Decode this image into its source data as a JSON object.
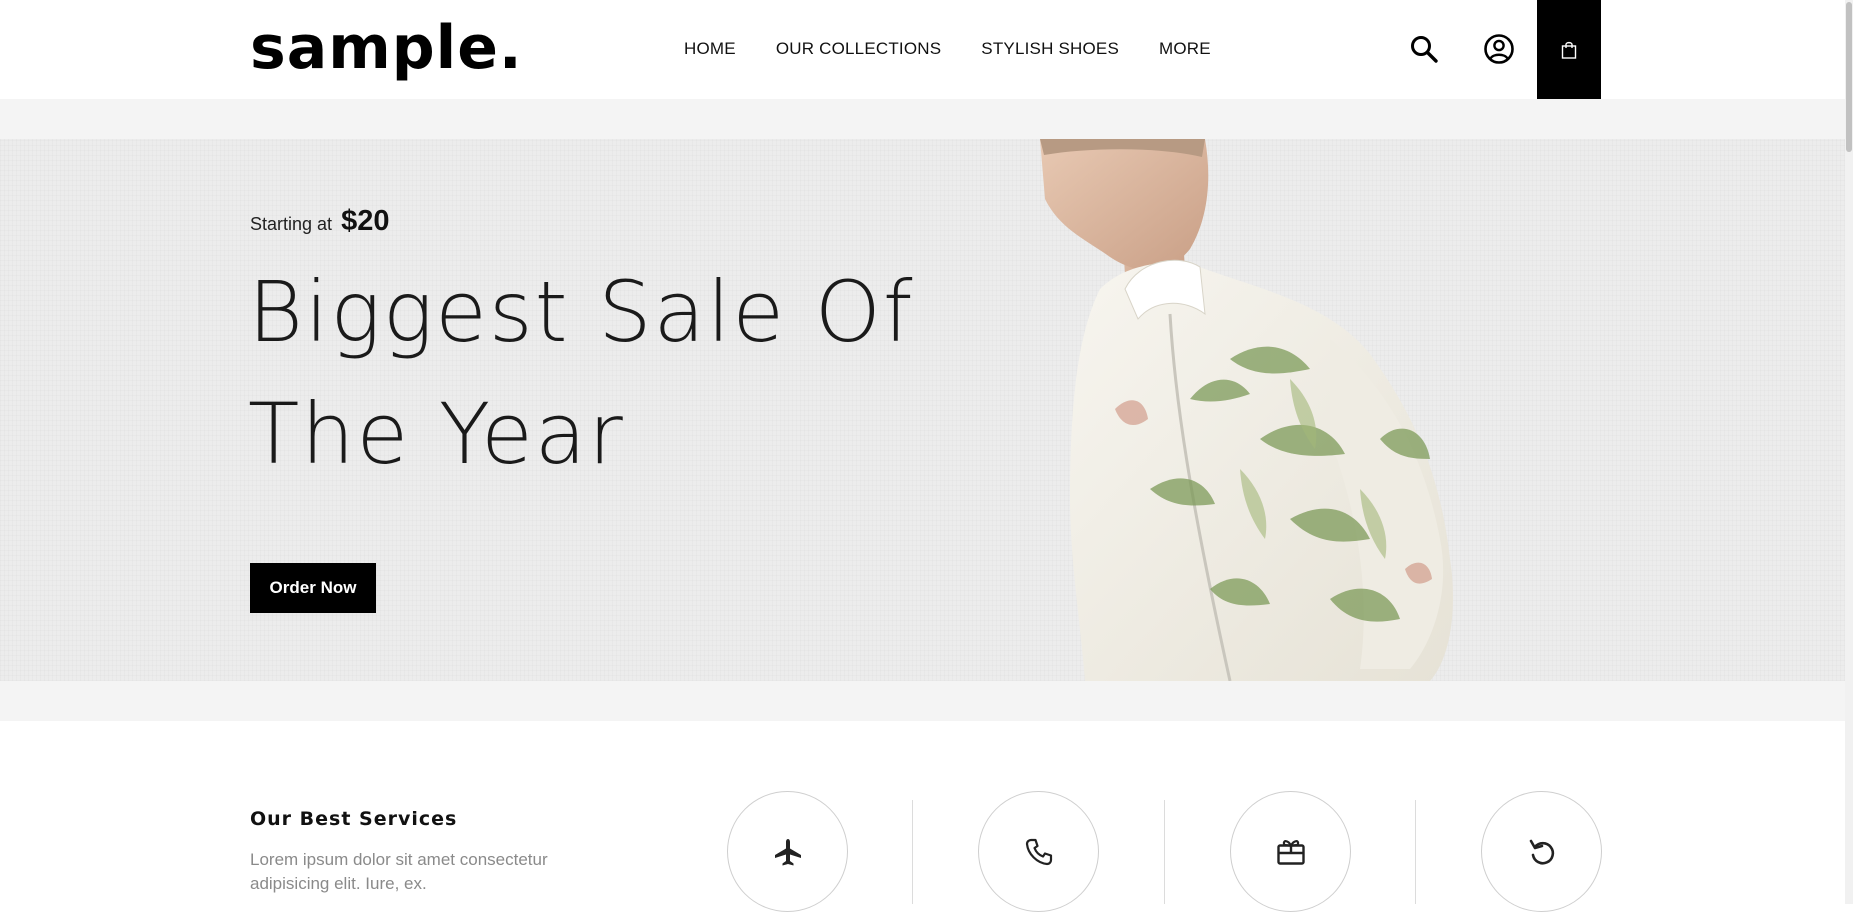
{
  "header": {
    "logo": "sample.",
    "nav": [
      "HOME",
      "OUR COLLECTIONS",
      "STYLISH SHOES",
      "MORE"
    ],
    "icons": [
      "search-icon",
      "user-icon",
      "shopping-bag-icon"
    ]
  },
  "hero": {
    "starting_prefix": "Starting at",
    "price": "$20",
    "headline_line1": "Biggest Sale Of",
    "headline_line2": "The Year",
    "cta": "Order Now"
  },
  "services": {
    "title": "Our Best Services",
    "description": "Lorem ipsum dolor sit amet consectetur adipisicing elit. Iure, ex.",
    "items": [
      {
        "icon": "airplane-icon"
      },
      {
        "icon": "phone-icon"
      },
      {
        "icon": "gift-icon"
      },
      {
        "icon": "return-icon"
      }
    ]
  },
  "colors": {
    "accent": "#000000",
    "hero_bg": "#ececec",
    "band_bg": "#f4f4f4",
    "muted_text": "#8a8a8a"
  }
}
